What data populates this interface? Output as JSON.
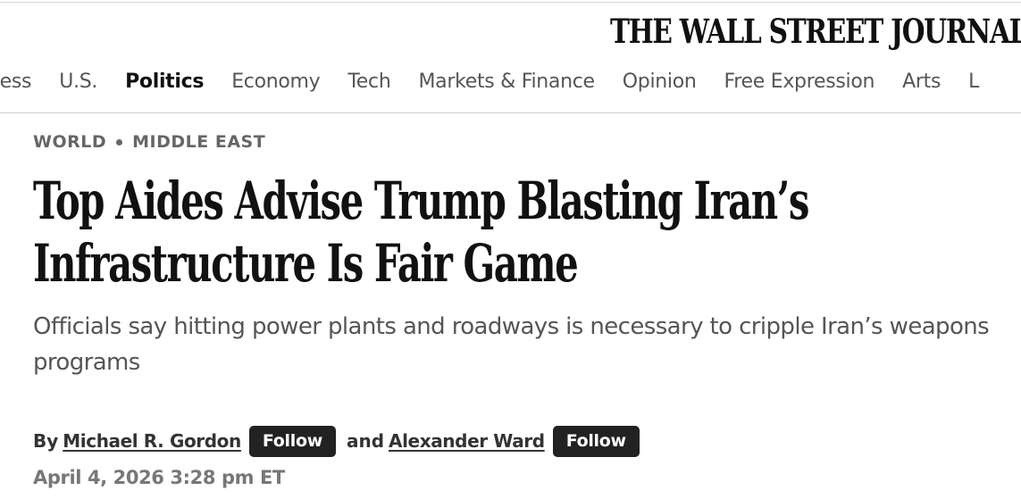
{
  "masthead": {
    "title": "THE WALL STREET JOURNAL."
  },
  "nav": {
    "items": [
      {
        "label": "ness",
        "active": false
      },
      {
        "label": "U.S.",
        "active": false
      },
      {
        "label": "Politics",
        "active": true
      },
      {
        "label": "Economy",
        "active": false
      },
      {
        "label": "Tech",
        "active": false
      },
      {
        "label": "Markets & Finance",
        "active": false
      },
      {
        "label": "Opinion",
        "active": false
      },
      {
        "label": "Free Expression",
        "active": false
      },
      {
        "label": "Arts",
        "active": false
      },
      {
        "label": "L",
        "active": false
      }
    ]
  },
  "article": {
    "kicker": {
      "section": "WORLD",
      "subsection": "MIDDLE EAST"
    },
    "headline": {
      "line1": "Top Aides Advise Trump Blasting Iran’s",
      "line2": "Infrastructure Is Fair Game"
    },
    "dek": "Officials say hitting power plants and roadways is necessary to cripple Iran’s weapons programs",
    "byline": {
      "by": "By",
      "author1": "Michael R. Gordon",
      "follow1": "Follow",
      "and": "and",
      "author2": "Alexander Ward",
      "follow2": "Follow"
    },
    "timestamp": "April 4, 2026 3:28 pm ET"
  }
}
